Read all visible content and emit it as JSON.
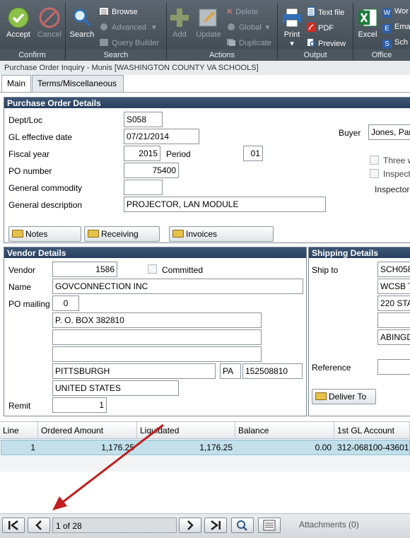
{
  "ribbon": {
    "accept": "Accept",
    "cancel": "Cancel",
    "search": "Search",
    "browse": "Browse",
    "advanced": "Advanced",
    "query_builder": "Query Builder",
    "add": "Add",
    "update": "Update",
    "delete": "Delete",
    "global": "Global",
    "duplicate": "Duplicate",
    "print": "Print",
    "text_file": "Text file",
    "pdf": "PDF",
    "preview": "Preview",
    "excel": "Excel",
    "word": "Wor",
    "email": "Ema",
    "schedule": "Sch",
    "groups": {
      "confirm": "Confirm",
      "search": "Search",
      "actions": "Actions",
      "output": "Output",
      "office": "Office"
    }
  },
  "window_title": "Purchase Order Inquiry - Munis [WASHINGTON COUNTY VA SCHOOLS]",
  "tabs": {
    "main": "Main",
    "terms": "Terms/Miscellaneous"
  },
  "po": {
    "header": "Purchase Order Details",
    "dept_label": "Dept/Loc",
    "dept": "S058",
    "gl_date_label": "GL effective date",
    "gl_date": "07/21/2014",
    "fiscal_label": "Fiscal year",
    "fiscal": "2015",
    "period_label": "Period",
    "period": "01",
    "po_number_label": "PO number",
    "po_number": "75400",
    "commodity_label": "General commodity",
    "commodity": "",
    "desc_label": "General description",
    "desc": "PROJECTOR, LAN MODULE",
    "buyer_label": "Buyer",
    "buyer": "Jones, Par",
    "three_way": "Three w",
    "inspect": "Inspect",
    "inspector": "Inspector",
    "notes": "Notes",
    "receiving": "Receiving",
    "invoices": "Invoices"
  },
  "vendor": {
    "header": "Vendor Details",
    "vendor_label": "Vendor",
    "vendor": "1586",
    "committed": "Committed",
    "name_label": "Name",
    "name": "GOVCONNECTION INC",
    "mailing_label": "PO mailing",
    "mailing": "0",
    "addr1": "P. O. BOX 382810",
    "addr2": "",
    "addr3": "",
    "city": "PITTSBURGH",
    "state": "PA",
    "zip": "152508810",
    "country": "UNITED STATES",
    "remit_label": "Remit",
    "remit": "1"
  },
  "shipping": {
    "header": "Shipping Details",
    "ship_to_label": "Ship to",
    "ship_to": "SCH058",
    "line1": "WCSB T",
    "line2": "220 STA",
    "line3": "",
    "line4": "ABINGD",
    "reference_label": "Reference",
    "reference": "",
    "deliver_to": "Deliver To"
  },
  "grid": {
    "columns": [
      "Line",
      "Ordered Amount",
      "Liquidated",
      "Balance",
      "1st GL Account"
    ],
    "rows": [
      [
        "1",
        "1,176.25",
        "1,176.25",
        "0.00",
        "312-068100-43601"
      ]
    ]
  },
  "nav": {
    "record": "1 of 28",
    "attachments": "Attachments (0)"
  },
  "colors": {
    "ribbon": "#4a545c",
    "header": "#2f4868",
    "selected_row": "#c2dfea",
    "arrow": "#c0201e"
  }
}
